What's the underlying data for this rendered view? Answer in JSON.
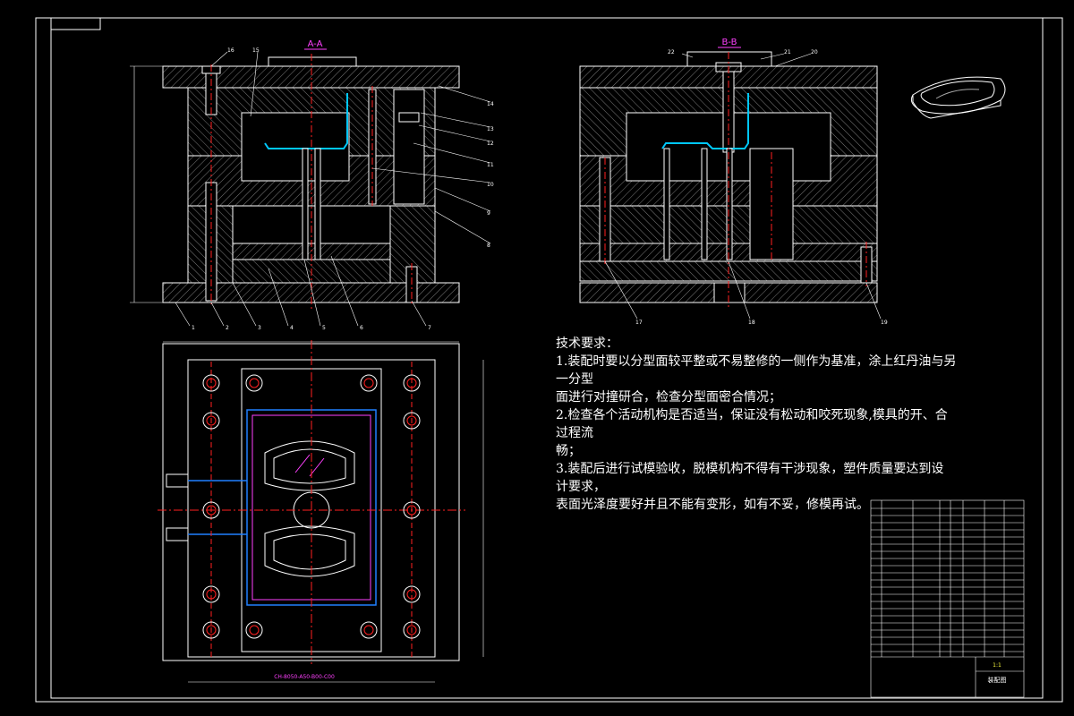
{
  "sections": {
    "aa_title": "A-A",
    "bb_title": "B-B"
  },
  "callouts_left": [
    "1",
    "2",
    "3",
    "4",
    "5",
    "6",
    "7",
    "8",
    "9",
    "10",
    "11",
    "12",
    "13",
    "14",
    "15",
    "16"
  ],
  "callouts_right": [
    "17",
    "18",
    "19",
    "20",
    "21",
    "22"
  ],
  "plan_dimension_label": "CH-8050-A50-B00-C00",
  "tech_requirements": {
    "heading": "技术要求：",
    "lines": [
      "1.装配时要以分型面较平整或不易整修的一侧作为基准，涂上红丹油与另",
      "一分型",
      "面进行对撞研合，检查分型面密合情况；",
      "2.检查各个活动机构是否适当，保证没有松动和咬死现象,模具的开、合",
      "过程流",
      "畅；",
      "3.装配后进行试模验收，脱模机构不得有干涉现象，塑件质量要达到设",
      "计要求，",
      "表面光泽度要好并且不能有变形，如有不妥，修模再试。"
    ]
  },
  "title_block": {
    "drawing_name": "装配图",
    "scale": "1:1"
  },
  "colors": {
    "background": "#000000",
    "line": "#ffffff",
    "centerline": "#ff2020",
    "cavity": "#00c8ff",
    "magenta": "#ff40ff"
  }
}
